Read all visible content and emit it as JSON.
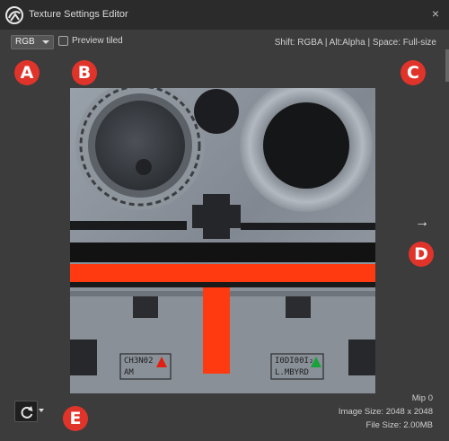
{
  "window": {
    "title": "Texture Settings Editor",
    "close_glyph": "×",
    "logo_icon": "app-logo-icon"
  },
  "toolbar": {
    "channel_select": {
      "value": "RGB"
    },
    "preview_tiled": {
      "label": "Preview tiled",
      "checked": false
    },
    "shortcuts_hint": "Shift: RGBA | Alt:Alpha | Space: Full-size"
  },
  "annotations": [
    "A",
    "B",
    "C",
    "D",
    "E"
  ],
  "colors": {
    "annotation_red": "#e0342a",
    "panel_bg": "#3c3c3c",
    "titlebar_bg": "#2b2b2b"
  },
  "texture": {
    "label_left_line1": "CH3N02",
    "label_left_line2": "AM",
    "label_right_line1": "I0DI00I₂",
    "label_right_line2": "L.MBYRD"
  },
  "navigation": {
    "next_glyph": "→"
  },
  "info": {
    "mip": "Mip 0",
    "image_size": "Image Size: 2048 x 2048",
    "file_size": "File Size: 2.00MB"
  },
  "footer": {
    "refresh_icon": "refresh-icon"
  }
}
